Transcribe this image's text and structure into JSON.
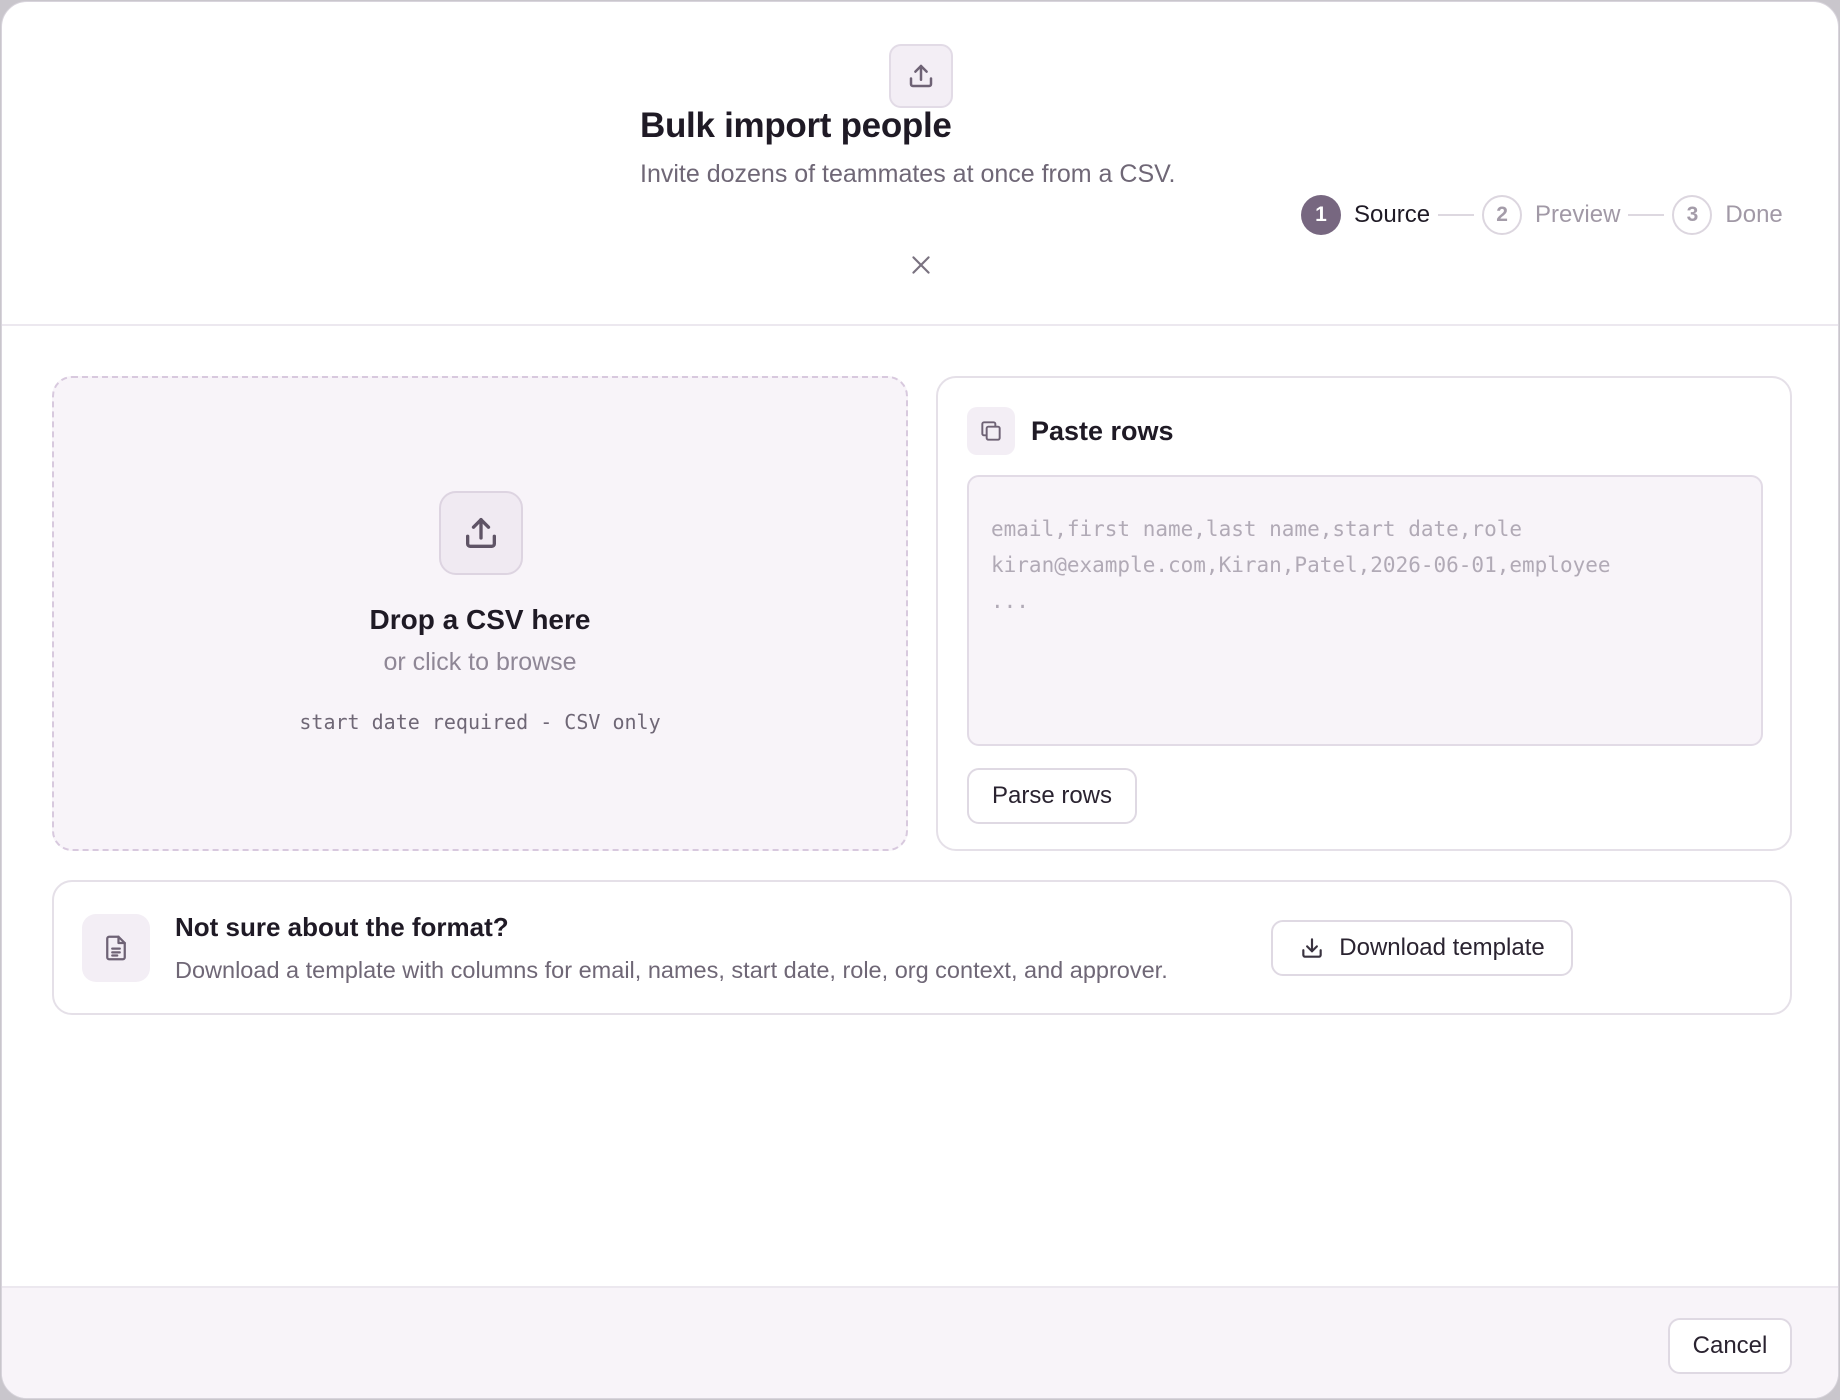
{
  "header": {
    "icon": "upload-icon",
    "title": "Bulk import people",
    "subtitle": "Invite dozens of teammates at once from a CSV.",
    "close_icon": "close-icon"
  },
  "stepper": {
    "steps": [
      {
        "number": "1",
        "label": "Source",
        "state": "active"
      },
      {
        "number": "2",
        "label": "Preview",
        "state": "inactive"
      },
      {
        "number": "3",
        "label": "Done",
        "state": "inactive"
      }
    ]
  },
  "dropzone": {
    "icon": "upload-icon",
    "title": "Drop a CSV here",
    "subtitle": "or click to browse",
    "hint": "start date required - CSV only"
  },
  "paste": {
    "icon": "copy-icon",
    "title": "Paste rows",
    "placeholder": "email,first name,last name,start date,role\nkiran@example.com,Kiran,Patel,2026-06-01,employee\n...",
    "parse_label": "Parse rows"
  },
  "template": {
    "icon": "document-icon",
    "title": "Not sure about the format?",
    "description": "Download a template with columns for email, names, start date, role, org context, and approver.",
    "button_icon": "download-icon",
    "button_label": "Download template"
  },
  "footer": {
    "cancel_label": "Cancel"
  },
  "colors": {
    "accent": "#776780",
    "surface_tint": "#f8f4f9",
    "border": "#e5e0e8"
  }
}
